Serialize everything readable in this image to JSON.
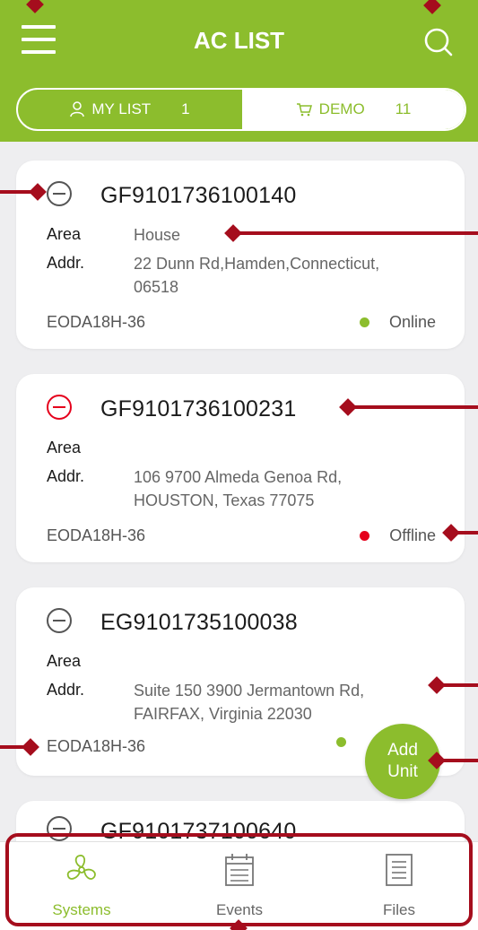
{
  "header": {
    "title": "AC LIST",
    "menu_icon": "hamburger-menu-icon",
    "search_icon": "search-icon",
    "background": "#8cbd2d"
  },
  "segments": [
    {
      "label": "MY LIST",
      "count": "1",
      "icon": "person-icon"
    },
    {
      "label": "DEMO",
      "count": "11",
      "icon": "cart-icon"
    }
  ],
  "units": [
    {
      "serial": "GF9101736100140",
      "area_label": "Area",
      "area": "House",
      "addr_label": "Addr.",
      "addr_line1": "22 Dunn Rd,Hamden,Connecticut,",
      "addr_line2": "06518",
      "model": "EODA18H-36",
      "status": "Online",
      "status_color": "#8cbd2d",
      "remove_icon_color": "#555555"
    },
    {
      "serial": "GF9101736100231",
      "area_label": "Area",
      "area": "",
      "addr_label": "Addr.",
      "addr_line1": "106 9700 Almeda Genoa Rd,",
      "addr_line2": "HOUSTON, Texas 77075",
      "model": "EODA18H-36",
      "status": "Offline",
      "status_color": "#e5001c",
      "remove_icon_color": "#e5001c"
    },
    {
      "serial": "EG9101735100038",
      "area_label": "Area",
      "area": "",
      "addr_label": "Addr.",
      "addr_line1": "Suite 150 3900  Jermantown Rd,",
      "addr_line2": "FAIRFAX, Virginia 22030",
      "model": "EODA18H-36",
      "status": "",
      "status_color": "#8cbd2d",
      "remove_icon_color": "#555555"
    },
    {
      "serial": "GF9101737100640"
    }
  ],
  "fab": {
    "line1": "Add",
    "line2": "Unit"
  },
  "tabs": [
    {
      "label": "Systems",
      "icon": "fan-icon",
      "active": true
    },
    {
      "label": "Events",
      "icon": "calendar-icon",
      "active": false
    },
    {
      "label": "Files",
      "icon": "document-list-icon",
      "active": false
    }
  ],
  "colors": {
    "accent": "#8cbd2d",
    "annotation": "#a50d1d",
    "offline": "#e5001c"
  }
}
